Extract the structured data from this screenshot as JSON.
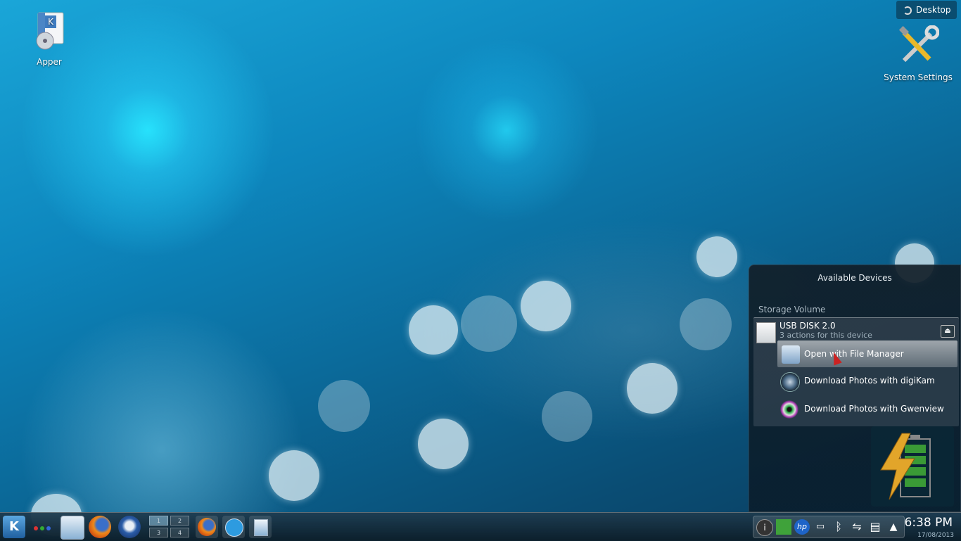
{
  "desktop": {
    "icons": [
      {
        "label": "Apper",
        "icon": "apper-package-icon"
      },
      {
        "label": "System Settings",
        "icon": "system-settings-tools-icon"
      }
    ],
    "desktop_button": "Desktop"
  },
  "device_notifier": {
    "title": "Available Devices",
    "section": "Storage Volume",
    "device": {
      "name": "USB DISK 2.0",
      "subtitle": "3 actions for this device",
      "icon": "usb-drive-icon",
      "eject_icon": "eject-icon"
    },
    "actions": [
      {
        "label": "Open with File Manager",
        "icon": "file-manager-icon",
        "highlighted": true
      },
      {
        "label": "Download Photos with digiKam",
        "icon": "digikam-icon"
      },
      {
        "label": "Download Photos with Gwenview",
        "icon": "gwenview-icon"
      }
    ]
  },
  "battery_widget": {
    "icon": "battery-charging-icon"
  },
  "panel": {
    "launcher_icon": "kde-kickoff-icon",
    "activities_icon": "activities-icon",
    "quicklaunch": [
      "dolphin-icon",
      "firefox-icon",
      "thunderbird-icon"
    ],
    "pager": [
      "1",
      "2",
      "3",
      "4"
    ],
    "tasks": [
      "firefox-icon",
      "kopete-icon",
      "dolphin-icon"
    ],
    "tray": [
      "info-icon",
      "network-icon",
      "hp-icon",
      "printer-icon",
      "bluetooth-icon",
      "usb-icon",
      "clipboard-icon",
      "expand-arrow-icon"
    ],
    "clock": {
      "time": "6:38 PM",
      "date": "17/08/2013"
    }
  },
  "colors": {
    "accent": "#1aa6d8",
    "panel": "#1e3c50"
  }
}
